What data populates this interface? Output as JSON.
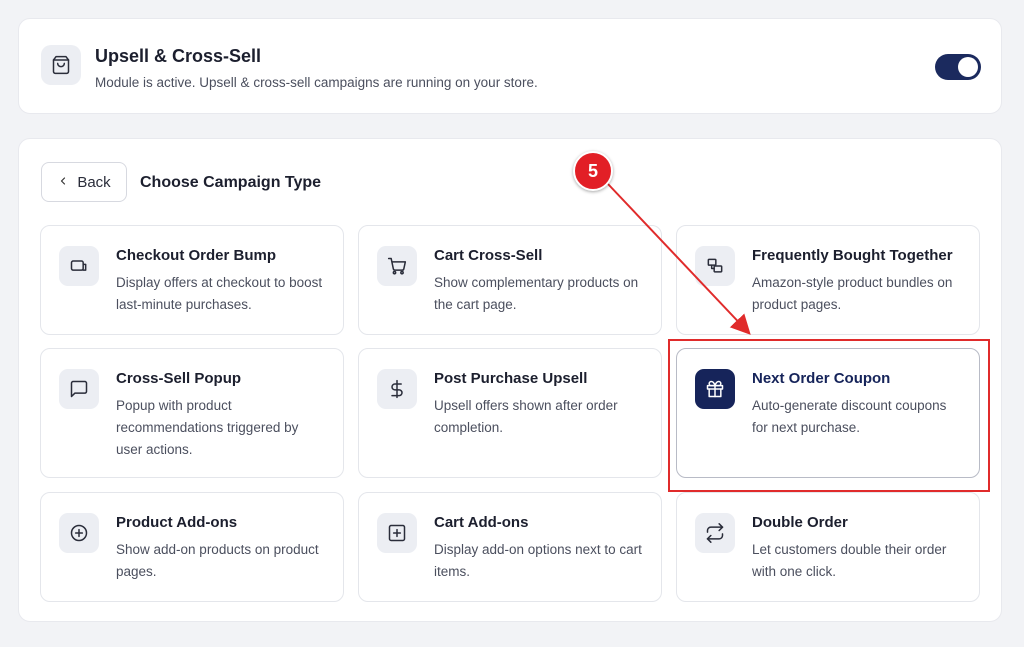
{
  "module": {
    "title": "Upsell & Cross-Sell",
    "subtitle": "Module is active. Upsell & cross-sell campaigns are running on your store.",
    "icon": "shopping-bag-icon",
    "toggle_on": true,
    "toggle_color": "#1b2a5e"
  },
  "header": {
    "back_label": "Back",
    "title": "Choose Campaign Type"
  },
  "campaigns": [
    {
      "title": "Checkout Order Bump",
      "desc": "Display offers at checkout to boost last-minute purchases.",
      "icon": "card-icon",
      "selected": false
    },
    {
      "title": "Cart Cross-Sell",
      "desc": "Show complementary products on the cart page.",
      "icon": "cart-icon",
      "selected": false
    },
    {
      "title": "Frequently Bought Together",
      "desc": "Amazon-style product bundles on product pages.",
      "icon": "bundle-icon",
      "selected": false
    },
    {
      "title": "Cross-Sell Popup",
      "desc": "Popup with product recommendations triggered by user actions.",
      "icon": "chat-icon",
      "selected": false
    },
    {
      "title": "Post Purchase Upsell",
      "desc": "Upsell offers shown after order completion.",
      "icon": "dollar-icon",
      "selected": false
    },
    {
      "title": "Next Order Coupon",
      "desc": "Auto-generate discount coupons for next purchase.",
      "icon": "gift-icon",
      "selected": true
    },
    {
      "title": "Product Add-ons",
      "desc": "Show add-on products on product pages.",
      "icon": "plus-circle-icon",
      "selected": false
    },
    {
      "title": "Cart Add-ons",
      "desc": "Display add-on options next to cart items.",
      "icon": "plus-square-icon",
      "selected": false
    },
    {
      "title": "Double Order",
      "desc": "Let customers double their order with one click.",
      "icon": "repeat-icon",
      "selected": false
    }
  ],
  "annotation": {
    "step_number": "5",
    "color": "#e02b2b"
  },
  "colors": {
    "accent": "#16245a",
    "background": "#f2f3f6"
  }
}
